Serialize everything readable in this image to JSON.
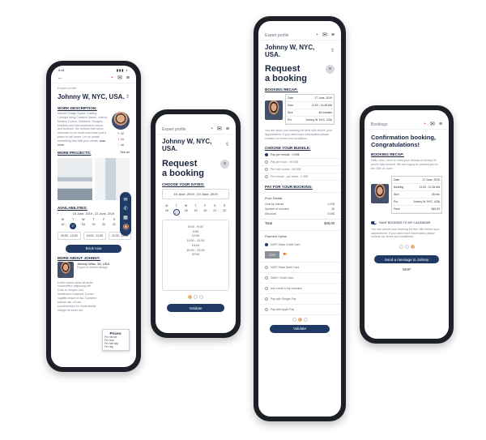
{
  "status_time": "9:41",
  "phone1": {
    "top_label": "Expert profile",
    "name": "Johnny W, NYC, USA.",
    "work_desc_title": "WORK DESCRIPTION:",
    "work_desc_text": "Interior Design Space Crafting. Lifestyle living Creative thinker. Interior Modern Colour, Solutions. Designs, timeless and interventions in colour and textures. We believe that home deserves to be much more than just a place to call home. Let us create something that fulfil your needs.",
    "read_more": "read more",
    "counts": [
      "32",
      "15",
      "46"
    ],
    "projects_title": "MORE PROJECTS:",
    "see_all": "See all",
    "availability_title": "AVAILABILITIES:",
    "range": "16 June, 2019 - 22 June, 2019",
    "days": [
      "M",
      "T",
      "W",
      "T",
      "F",
      "S",
      "S"
    ],
    "dates": [
      "16",
      "17",
      "18",
      "19",
      "20",
      "21",
      "22"
    ],
    "slots": [
      "09:00 - 10:00",
      "10:00 - 11:00",
      "11:00 - 12:00"
    ],
    "book_label": "Book now",
    "about_title": "MORE ABOUT JOHNNY:",
    "about_name": "Johnny Wise, 36, USA",
    "about_sub": "Expert in interior design",
    "about_text": "Lorem ipsum dolor sit amet, consectetur adipiscing elit. Cras eu tempor orci. Vestibulum euismod. Donec sagittis neque id dui. Curabitur blandit nisi. Ut nec condimentum ex. Nulla facilisi. Integer sit amet dui.",
    "prices_title": "Prices:",
    "prices_lines": [
      "Per minute",
      "Per hour",
      "Per half day",
      "Per day"
    ]
  },
  "phone2": {
    "top_label": "Expert profile",
    "name": "Johnny W, NYC, USA.",
    "title_line1": "Request",
    "title_line2": "a booking",
    "choose_dates": "CHOOSE YOUR DATES:",
    "date_range": "16 June, 2019 - 22 June, 2019",
    "days": [
      "M",
      "T",
      "W",
      "T",
      "F",
      "S",
      "S"
    ],
    "dates": [
      "16",
      "17",
      "18",
      "19",
      "20",
      "21",
      "22"
    ],
    "times": [
      "8:00 - 9:00",
      "9:00",
      "10:00",
      "11:00 - 12:00",
      "15:00",
      "16:00 - 22:00",
      "22:00"
    ],
    "validate": "Validate"
  },
  "phone3": {
    "top_label": "Expert profile",
    "name": "Johnny W, NYC, USA.",
    "title_line1": "Request",
    "title_line2": "a booking",
    "recap_title": "BOOKING RECAP:",
    "recap": [
      {
        "k": "Date",
        "v": "17 June, 2019"
      },
      {
        "k": "Hour",
        "v": "11:00 - 11:45 AM"
      },
      {
        "k": "Size",
        "v": "45 minutes"
      },
      {
        "k": "Pro",
        "v": "Johnny W. NYC, USA"
      }
    ],
    "recap_note": "You are about you booking the time with before your appointment. If you need more information please contact our terms and conditions.",
    "bundle_title": "CHOOSE YOUR BUNDLE:",
    "bundles": [
      "Pay per minute : 0.99$",
      "Pay per hour : 49.00$",
      "Per half course : 49.00$",
      "Per minute - per week : 0.99$"
    ],
    "pay_title": "PAY FOR YOUR BOOKING:",
    "price_details": "Price Details",
    "price_lines": [
      {
        "k": "Cost by minute",
        "v": "1.00$"
      },
      {
        "k": "Number of minutes",
        "v": "45"
      },
      {
        "k": "Discount",
        "v": "0.00$"
      }
    ],
    "total_k": "Total",
    "total_v": "$40,00",
    "payment_option": "Payment Option",
    "payments": [
      "HDFC Bank Credit Card",
      "HDFC Bank Debit Card",
      "Debit / Credit Card",
      "Add credit to my overview",
      "Pay with Google Pay",
      "Pay with Apple Pay"
    ],
    "cvv": "CVV",
    "validate": "Validate"
  },
  "phone4": {
    "top_label": "Bookings",
    "title_line1": "Confirmation booking,",
    "title_line2": "Congratulations!",
    "recap_title": "BOOKING RECAP:",
    "intro": "Hello John, Here to meet your friends of Johnny W. you're fully booked. We are happy to connect you to the 10th of June!",
    "recap": [
      {
        "k": "Date",
        "v": "17 June, 2019"
      },
      {
        "k": "Booking",
        "v": "11:00 - 11:45 AM"
      },
      {
        "k": "Size",
        "v": "45 min"
      },
      {
        "k": "Pro",
        "v": "Johnny W. NYC, USA"
      },
      {
        "k": "Price",
        "v": "$40,00"
      }
    ],
    "save_label": "SAVE BOOKING TO MY CALENDAR",
    "cancel_note": "You can cancel your booking for free 48h before your appointment. If you need more information please consult our terms and conditions.",
    "message_btn": "Send a message to Johnny",
    "skip": "SKIP"
  }
}
